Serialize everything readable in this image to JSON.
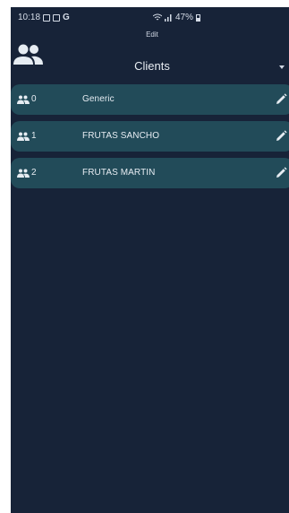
{
  "status_bar": {
    "time": "10:18",
    "network_letter": "G",
    "battery": "47%"
  },
  "header": {
    "edit_label": "Edit",
    "title": "Clients",
    "icon": "group-icon"
  },
  "clients": [
    {
      "index": "0",
      "name": "Generic"
    },
    {
      "index": "1",
      "name": "FRUTAS SANCHO"
    },
    {
      "index": "2",
      "name": "FRUTAS MARTIN"
    }
  ],
  "colors": {
    "background": "#172338",
    "row": "#224b59",
    "text": "#e6ecf2"
  }
}
